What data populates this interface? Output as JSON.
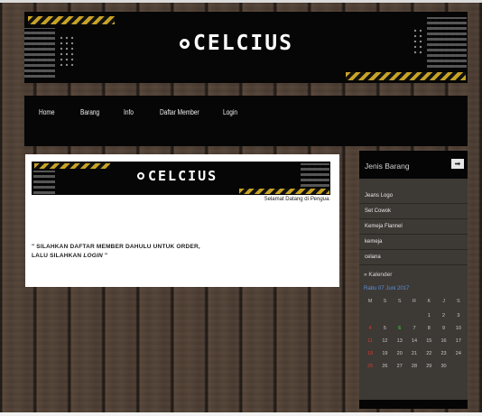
{
  "brand": {
    "logo_text": "CELCIUS"
  },
  "nav": {
    "items": [
      {
        "label": "Home"
      },
      {
        "label": "Barang"
      },
      {
        "label": "Info"
      },
      {
        "label": "Daftar Member"
      },
      {
        "label": "Login"
      }
    ]
  },
  "main": {
    "welcome_prefix": "Selamat Datang di",
    "welcome_name": "Pengua.",
    "notice_line1": "\" SILAHKAN DAFTAR MEMBER DAHULU UNTUK ORDER,",
    "notice_line2_prefix": "LALU SILAHKAN",
    "notice_line2_em": "LOGIN",
    "notice_line2_suffix": "\""
  },
  "sidebar": {
    "title": "Jenis Barang",
    "arrow_glyph": "➡",
    "categories": [
      {
        "label": "Jeans Logo"
      },
      {
        "label": "Set Cowok"
      },
      {
        "label": "Kemeja Flannel"
      },
      {
        "label": "kemeja"
      },
      {
        "label": "celana"
      }
    ],
    "calendar_label": "Kalender",
    "calendar_date": "Rabu 07 Juni 2017",
    "weekdays": [
      "M",
      "S",
      "S",
      "R",
      "K",
      "J",
      "S"
    ],
    "days": [
      "",
      "",
      "",
      "",
      "1",
      "2",
      "3",
      "4",
      "5",
      "6",
      "7",
      "8",
      "9",
      "10",
      "11",
      "12",
      "13",
      "14",
      "15",
      "16",
      "17",
      "18",
      "19",
      "20",
      "21",
      "22",
      "23",
      "24",
      "25",
      "26",
      "27",
      "28",
      "29",
      "30",
      ""
    ],
    "today": "6"
  },
  "colors": {
    "hazard_yellow": "#c8a326",
    "today_green": "#3bb33b",
    "sunday_red": "#d43c32",
    "date_blue": "#5e8fd6"
  }
}
